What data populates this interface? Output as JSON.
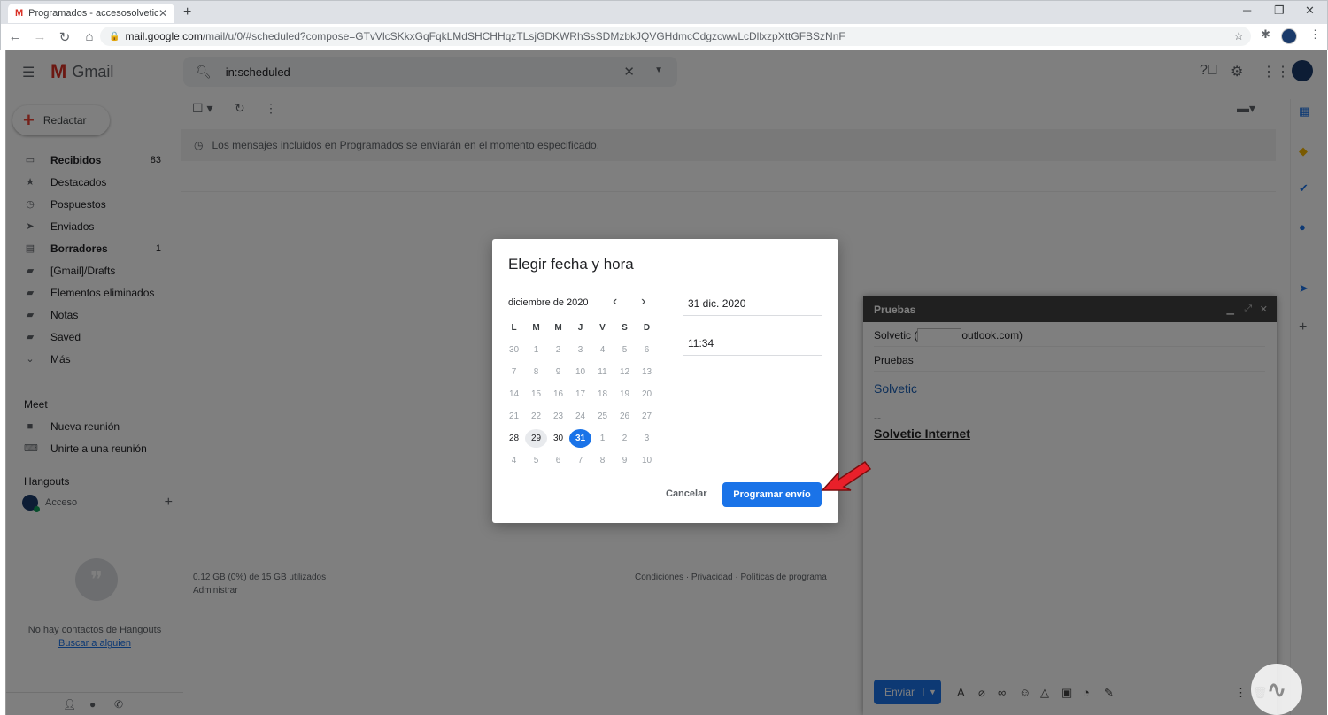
{
  "browser": {
    "tab_title": "Programados - accesosolvetic1@",
    "url_domain": "mail.google.com",
    "url_path": "/mail/u/0/#scheduled?compose=GTvVlcSKkxGqFqkLMdSHCHHqzTLsjGDKWRhSsSDMzbkJQVGHdmcCdgzcwwLcDllxzpXttGFBSzNnF"
  },
  "gmail": {
    "brand": "Gmail",
    "search_query": "in:scheduled",
    "compose_label": "Redactar",
    "nav": [
      {
        "label": "Recibidos",
        "count": "83",
        "bold": true,
        "icon": "inbox-icon",
        "glyph": "▭"
      },
      {
        "label": "Destacados",
        "count": "",
        "bold": false,
        "icon": "star-icon",
        "glyph": "★"
      },
      {
        "label": "Pospuestos",
        "count": "",
        "bold": false,
        "icon": "clock-icon",
        "glyph": "◷"
      },
      {
        "label": "Enviados",
        "count": "",
        "bold": false,
        "icon": "send-icon",
        "glyph": "➤"
      },
      {
        "label": "Borradores",
        "count": "1",
        "bold": true,
        "icon": "draft-icon",
        "glyph": "▤"
      },
      {
        "label": "[Gmail]/Drafts",
        "count": "",
        "bold": false,
        "icon": "label-icon",
        "glyph": "▰"
      },
      {
        "label": "Elementos eliminados",
        "count": "",
        "bold": false,
        "icon": "label-icon",
        "glyph": "▰"
      },
      {
        "label": "Notas",
        "count": "",
        "bold": false,
        "icon": "label-icon",
        "glyph": "▰"
      },
      {
        "label": "Saved",
        "count": "",
        "bold": false,
        "icon": "label-icon",
        "glyph": "▰"
      },
      {
        "label": "Más",
        "count": "",
        "bold": false,
        "icon": "chevron-down-icon",
        "glyph": "⌄"
      }
    ],
    "meet": {
      "title": "Meet",
      "new_meeting": "Nueva reunión",
      "join_meeting": "Unirte a una reunión"
    },
    "hangouts": {
      "title": "Hangouts",
      "account": "Acceso",
      "no_contacts": "No hay contactos de Hangouts",
      "find_someone": "Buscar a alguien"
    },
    "scheduled_notice": "Los mensajes incluidos en Programados se enviarán en el momento especificado.",
    "footer": {
      "storage": "0.12 GB (0%) de 15 GB utilizados",
      "manage": "Administrar",
      "links": "Condiciones · Privacidad · Políticas de programa"
    }
  },
  "compose": {
    "header": "Pruebas",
    "to_prefix": "Solvetic (",
    "to_suffix": "outlook.com)",
    "subject": "Pruebas",
    "body": "Solvetic",
    "sig_dash": "--",
    "signature": "Solvetic Internet",
    "send_label": "Enviar"
  },
  "dialog": {
    "title": "Elegir fecha y hora",
    "month": "diciembre de 2020",
    "weekdays": [
      "L",
      "M",
      "M",
      "J",
      "V",
      "S",
      "D"
    ],
    "weeks": [
      [
        "30",
        "1",
        "2",
        "3",
        "4",
        "5",
        "6"
      ],
      [
        "7",
        "8",
        "9",
        "10",
        "11",
        "12",
        "13"
      ],
      [
        "14",
        "15",
        "16",
        "17",
        "18",
        "19",
        "20"
      ],
      [
        "21",
        "22",
        "23",
        "24",
        "25",
        "26",
        "27"
      ],
      [
        "28",
        "29",
        "30",
        "31",
        "1",
        "2",
        "3"
      ],
      [
        "4",
        "5",
        "6",
        "7",
        "8",
        "9",
        "10"
      ]
    ],
    "today": "29",
    "selected": "31",
    "date_value": "31 dic. 2020",
    "time_value": "11:34",
    "cancel_label": "Cancelar",
    "schedule_label": "Programar envío"
  },
  "colors": {
    "accent": "#1a73e8",
    "compose_header": "#404040",
    "arrow": "#e8202a"
  }
}
